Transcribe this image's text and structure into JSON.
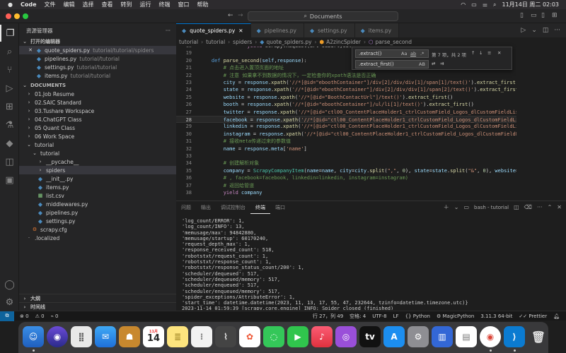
{
  "menubar": {
    "app": "Code",
    "items": [
      "文件",
      "编辑",
      "选择",
      "查看",
      "转到",
      "运行",
      "终端",
      "窗口",
      "帮助"
    ],
    "datetime": "11月14日 周二 02:03"
  },
  "titlebar": {
    "search": "Documents"
  },
  "sidebar": {
    "title": "资源管理器",
    "open_editors": "打开的编辑器",
    "open_files": [
      {
        "name": "quote_spiders.py",
        "path": "tutorial/tutorial/spiders"
      },
      {
        "name": "pipelines.py",
        "path": "tutorial/tutorial"
      },
      {
        "name": "settings.py",
        "path": "tutorial/tutorial"
      },
      {
        "name": "items.py",
        "path": "tutorial/tutorial"
      }
    ],
    "workspace": "DOCUMENTS",
    "tree": [
      "01.Job Resume",
      "02.SAIC Standard",
      "03.Tushare Workspace",
      "04.ChatGPT Class",
      "05 Quant Class",
      "06 Work Space",
      "tutorial",
      "tutorial",
      "__pycache__",
      "spiders",
      "__init__.py",
      "items.py",
      "list.csv",
      "middlewares.py",
      "pipelines.py",
      "settings.py",
      "scrapy.cfg",
      ".localized"
    ],
    "outline": "大纲",
    "timeline": "时间线"
  },
  "tabs": [
    "quote_spiders.py",
    "pipelines.py",
    "settings.py",
    "items.py"
  ],
  "breadcrumbs": [
    "tutorial",
    "tutorial",
    "spiders",
    "quote_spiders.py",
    "A2zincSpider",
    "parse_second"
  ],
  "find": {
    "query": ".extract()",
    "result": "第 7 项，共 2 项",
    "replace": ".extract_first()",
    "case_label": "Aa",
    "word_label": "ab",
    "regex_label": ".*",
    "preserve_label": "AB"
  },
  "code": {
    "line_numbers": [
      "18",
      "19",
      "20",
      "21",
      "22",
      "23",
      "24",
      "25",
      "26",
      "27",
      "28",
      "29",
      "30",
      "31",
      "32",
      "33",
      "34",
      "35",
      "36",
      "37",
      "38"
    ],
    "current_line": "27",
    "top_partial": "yield scrapy.Request(url=suburl,callbac"
  },
  "panel": {
    "tabs": [
      "问题",
      "输出",
      "调试控制台",
      "终端",
      "端口"
    ],
    "active_tab": "终端",
    "shell": "bash - tutorial",
    "lines": [
      "'log_count/ERROR': 1,",
      "'log_count/INFO': 13,",
      "'memusage/max': 94842880,",
      "'memusage/startup': 60170240,",
      "'request_depth_max': 1,",
      "'response_received_count': 518,",
      "'robotstxt/request_count': 1,",
      "'robotstxt/response_count': 1,",
      "'robotstxt/response_status_count/200': 1,",
      "'scheduler/dequeued': 517,",
      "'scheduler/dequeued/memory': 517,",
      "'scheduler/enqueued': 517,",
      "'scheduler/enqueued/memory': 517,",
      "'spider_exceptions/AttributeError': 1,",
      "'start_time': datetime.datetime(2023, 11, 13, 17, 55, 47, 232644, tzinfo=datetime.timezone.utc)}",
      "2023-11-14 01:59:39 [scrapy.core.engine] INFO: Spider closed (finished)",
      "luochangchuandeMacBook-Air:tutorial luochangchuan$ "
    ]
  },
  "statusbar": {
    "errors": "0",
    "warnings": "0",
    "ports": "0",
    "position": "行 27，列 49",
    "spaces": "空格: 4",
    "encoding": "UTF-8",
    "eol": "LF",
    "language": "Python",
    "extension": "MagicPython",
    "interpreter": "3.11.3 64-bit",
    "prettier": "Prettier"
  },
  "dock": {
    "calendar_month": "11月",
    "calendar_day": "14"
  },
  "colors": {
    "accent": "#0078d4",
    "background": "#1e1e1e",
    "sidebar": "#252526"
  }
}
